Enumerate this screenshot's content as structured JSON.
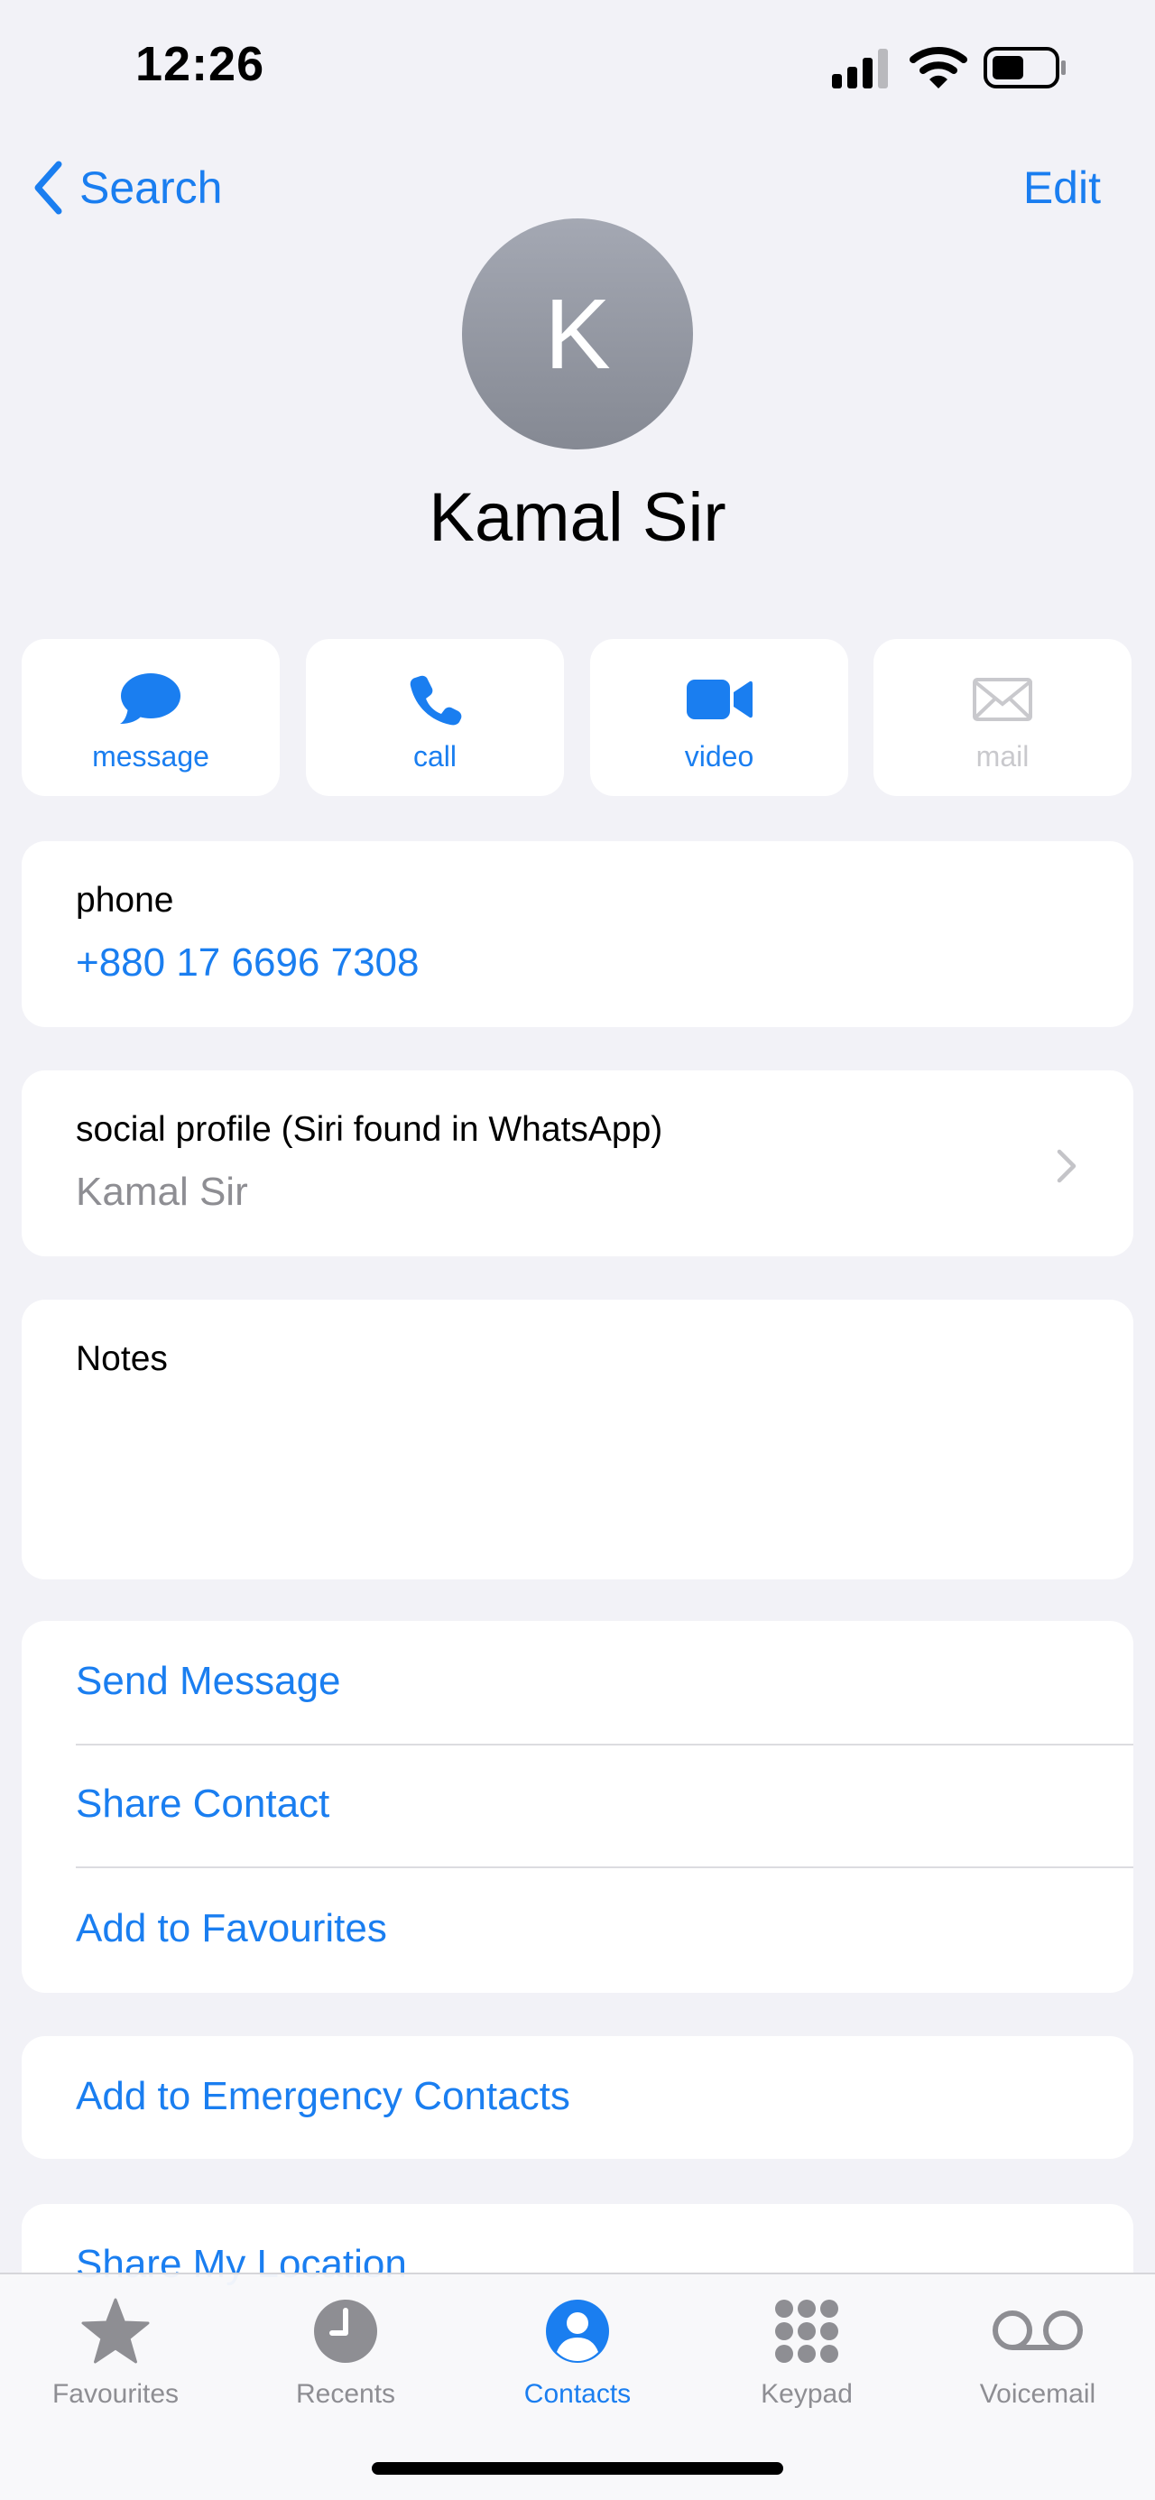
{
  "status_bar": {
    "time": "12:26"
  },
  "nav": {
    "back_label": "Search",
    "edit_label": "Edit"
  },
  "contact": {
    "initial": "K",
    "name": "Kamal Sir"
  },
  "actions": [
    {
      "label": "message",
      "icon": "message-bubble-icon"
    },
    {
      "label": "call",
      "icon": "phone-icon"
    },
    {
      "label": "video",
      "icon": "video-camera-icon"
    },
    {
      "label": "mail",
      "icon": "envelope-icon"
    }
  ],
  "phone": {
    "label": "phone",
    "value": "+880 17 6696 7308"
  },
  "social": {
    "label": "social profile (Siri found in WhatsApp)",
    "value": "Kamal Sir"
  },
  "notes": {
    "label": "Notes"
  },
  "options": {
    "send_message": "Send Message",
    "share_contact": "Share Contact",
    "add_favourites": "Add to Favourites",
    "add_emergency": "Add to Emergency Contacts",
    "share_location": "Share My Location"
  },
  "tabs": [
    {
      "label": "Favourites",
      "icon": "star-icon"
    },
    {
      "label": "Recents",
      "icon": "clock-icon"
    },
    {
      "label": "Contacts",
      "icon": "person-circle-icon",
      "active": true
    },
    {
      "label": "Keypad",
      "icon": "keypad-icon"
    },
    {
      "label": "Voicemail",
      "icon": "voicemail-icon"
    }
  ],
  "colors": {
    "accent": "#1a7ef0",
    "background": "#f2f2f7",
    "inactive": "#8e8e93",
    "disabled": "#c9c9cd"
  }
}
